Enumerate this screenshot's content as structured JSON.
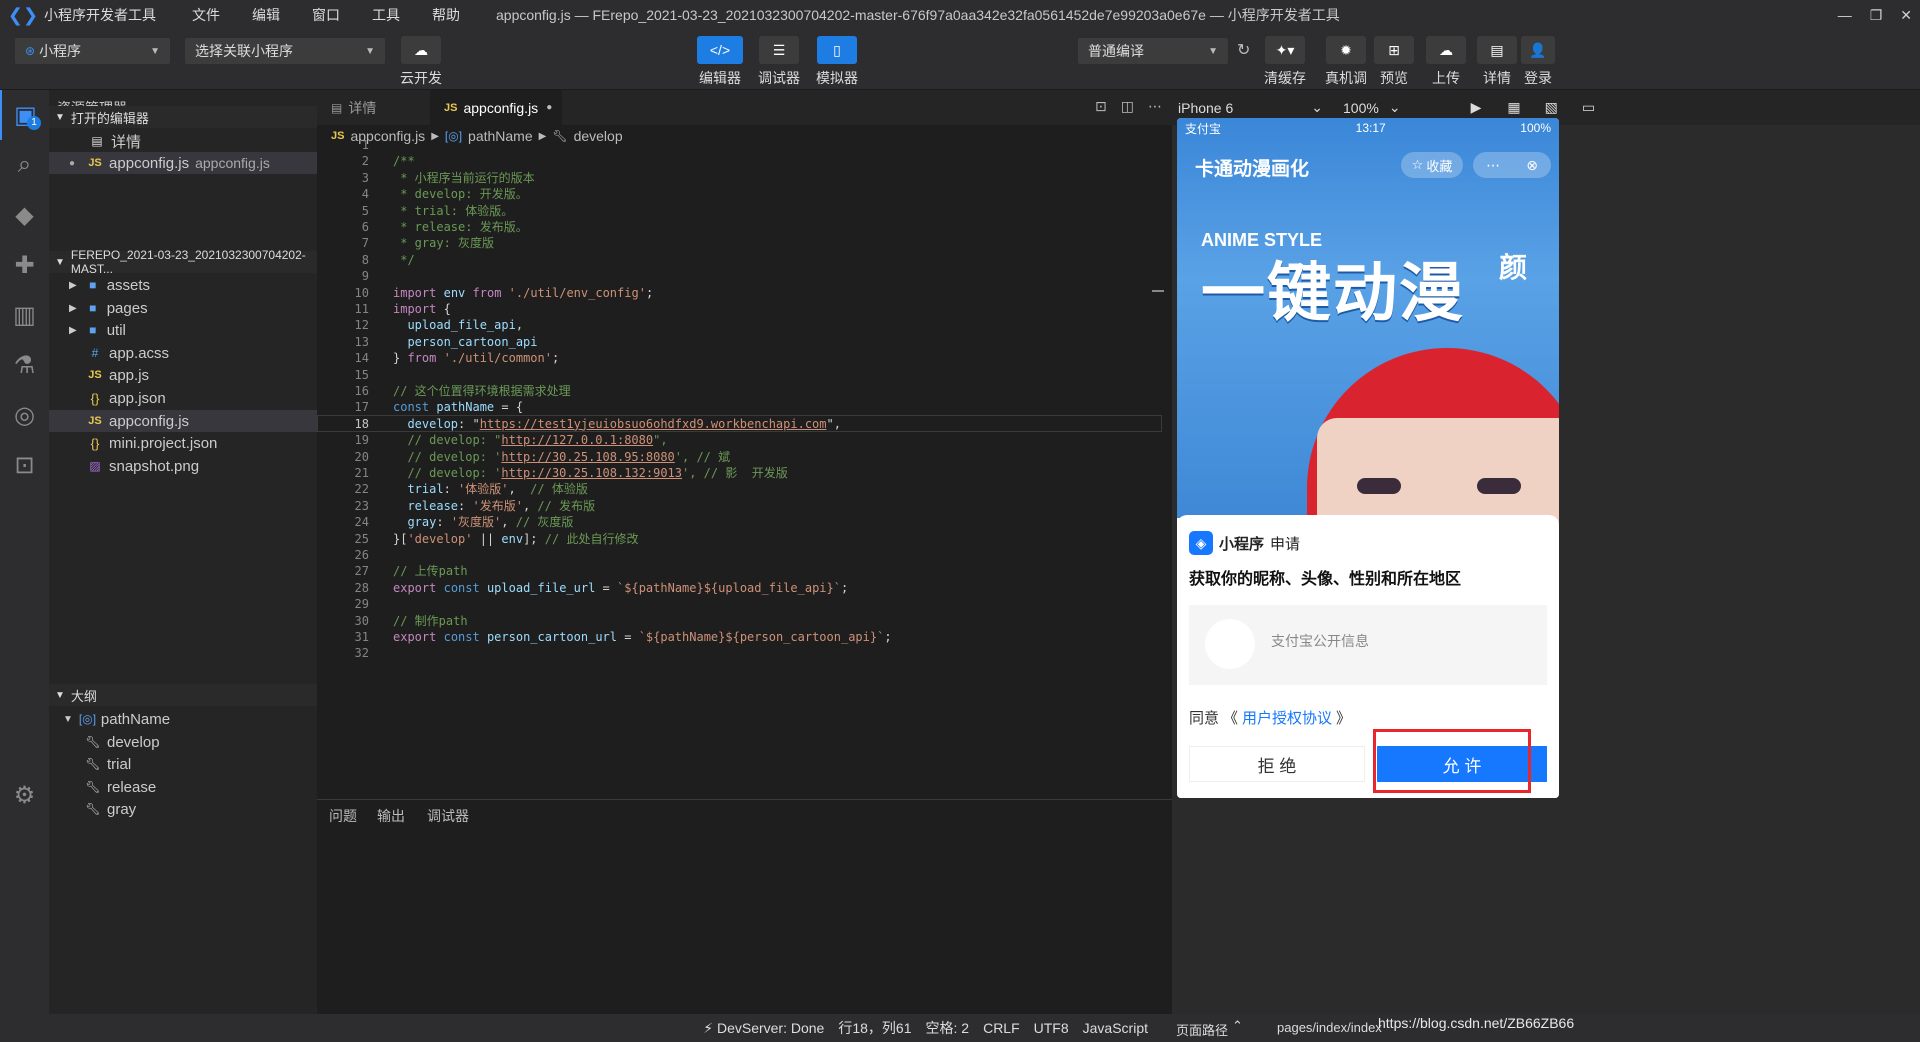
{
  "titlebar": {
    "app": "小程序开发者工具",
    "menus": [
      "文件",
      "编辑",
      "窗口",
      "工具",
      "帮助"
    ],
    "title": "appconfig.js — FErepo_2021-03-23_2021032300704202-master-676f97a0aa342e32fa0561452de7e99203a0e67e — 小程序开发者工具"
  },
  "toolbar": {
    "project_select": "小程序",
    "related_select": "选择关联小程序",
    "cloud_label": "云开发",
    "editor_label": "编辑器",
    "debugger_label": "调试器",
    "simulator_label": "模拟器",
    "compile_select": "普通编译",
    "right_buttons": [
      "清缓存",
      "真机调试",
      "预览",
      "上传",
      "详情",
      "登录"
    ]
  },
  "explorer": {
    "title": "资源管理器",
    "open_editors_title": "打开的编辑器",
    "open_editors": [
      {
        "name": "详情",
        "desc": ""
      },
      {
        "name": "appconfig.js",
        "desc": "appconfig.js"
      }
    ],
    "project_title": "FEREPO_2021-03-23_2021032300704202-MAST...",
    "files": [
      {
        "name": "assets",
        "kind": "folder"
      },
      {
        "name": "pages",
        "kind": "folder"
      },
      {
        "name": "util",
        "kind": "folder"
      },
      {
        "name": "app.acss",
        "kind": "acss"
      },
      {
        "name": "app.js",
        "kind": "js"
      },
      {
        "name": "app.json",
        "kind": "json"
      },
      {
        "name": "appconfig.js",
        "kind": "js"
      },
      {
        "name": "mini.project.json",
        "kind": "json"
      },
      {
        "name": "snapshot.png",
        "kind": "image"
      }
    ],
    "outline_title": "大纲",
    "outline": {
      "root": "pathName",
      "children": [
        "develop",
        "trial",
        "release",
        "gray"
      ]
    }
  },
  "editor": {
    "tabs": [
      {
        "label": "详情"
      },
      {
        "label": "appconfig.js"
      }
    ],
    "breadcrumb": [
      "appconfig.js",
      "pathName",
      "develop"
    ],
    "current_line": 18,
    "lines": [
      "",
      "/**",
      " * 小程序当前运行的版本",
      " * develop: 开发版。",
      " * trial: 体验版。",
      " * release: 发布版。",
      " * gray: 灰度版",
      " */",
      "",
      "import env from './util/env_config';",
      "import {",
      "  upload_file_api,",
      "  person_cartoon_api",
      "} from './util/common';",
      "",
      "// 这个位置得环境根据需求处理",
      "const pathName = {",
      "  develop: \"https://test1yjeuiobsuo6ohdfxd9.workbenchapi.com\",",
      "  // develop: \"http://127.0.0.1:8080\",",
      "  // develop: 'http://30.25.108.95:8080', // 斌",
      "  // develop: 'http://30.25.108.132:9013', // 影  开发版",
      "  trial: '体验版',  // 体验版",
      "  release: '发布版', // 发布版",
      "  gray: '灰度版', // 灰度版",
      "}['develop' || env]; // 此处自行修改",
      "",
      "// 上传path",
      "export const upload_file_url = `${pathName}${upload_file_api}`;",
      "",
      "// 制作path",
      "export const person_cartoon_url = `${pathName}${person_cartoon_api}`;",
      ""
    ]
  },
  "panel": {
    "tabs": [
      "问题",
      "输出",
      "调试器"
    ]
  },
  "statusbar": {
    "items": [
      "⚡ DevServer: Done",
      "行18，列61",
      "空格: 2",
      "CRLF",
      "UTF8",
      "JavaScript"
    ],
    "page_path_label": "页面路径",
    "page_path": "pages/index/index",
    "watermark": "https://blog.csdn.net/ZB66ZB66"
  },
  "simulator": {
    "device": "iPhone 6",
    "zoom": "100%",
    "phone_status": {
      "carrier": "支付宝",
      "time": "13:17",
      "battery": "100%"
    },
    "nav_title": "卡通动漫画化",
    "collect_label": "收藏",
    "banner_small": "ANIME STYLE",
    "banner_big": "一键动漫",
    "banner_tail": "颜",
    "dialog": {
      "app_name": "小程序",
      "app_suffix": "申请",
      "heading": "获取你的昵称、头像、性别和所在地区",
      "info_label": "支付宝公开信息",
      "agree_prefix": "同意",
      "agree_link": "用户授权协议",
      "reject_label": "拒 绝",
      "allow_label": "允 许"
    }
  },
  "colors": {
    "accent": "#1e7de2",
    "highlight": "#e8272d"
  }
}
